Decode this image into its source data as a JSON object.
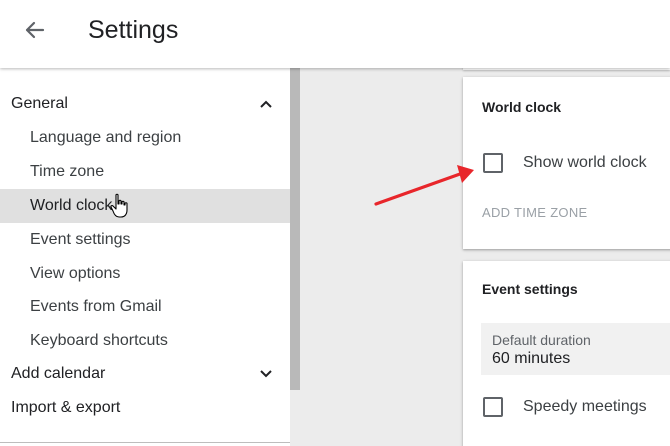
{
  "header": {
    "title": "Settings",
    "back_icon": "arrow-left-icon"
  },
  "sidebar": {
    "sections": [
      {
        "label": "General",
        "expanded": true,
        "caret": "chevron-up-icon"
      },
      {
        "label": "Add calendar",
        "expanded": false,
        "caret": "chevron-down-icon"
      },
      {
        "label": "Import & export"
      }
    ],
    "items": [
      {
        "label": "Language and region"
      },
      {
        "label": "Time zone"
      },
      {
        "label": "World clock",
        "active": true
      },
      {
        "label": "Event settings"
      },
      {
        "label": "View options"
      },
      {
        "label": "Events from Gmail"
      },
      {
        "label": "Keyboard shortcuts"
      }
    ]
  },
  "world_clock": {
    "title": "World clock",
    "show_label": "Show world clock",
    "show_checked": false,
    "add_time_zone": "ADD TIME ZONE"
  },
  "event_settings": {
    "title": "Event settings",
    "duration_label": "Default duration",
    "duration_value": "60 minutes",
    "speedy_label": "Speedy meetings",
    "speedy_checked": false
  },
  "colors": {
    "annotation_arrow": "#e8262b",
    "active_item_bg": "#e0e0e0"
  }
}
